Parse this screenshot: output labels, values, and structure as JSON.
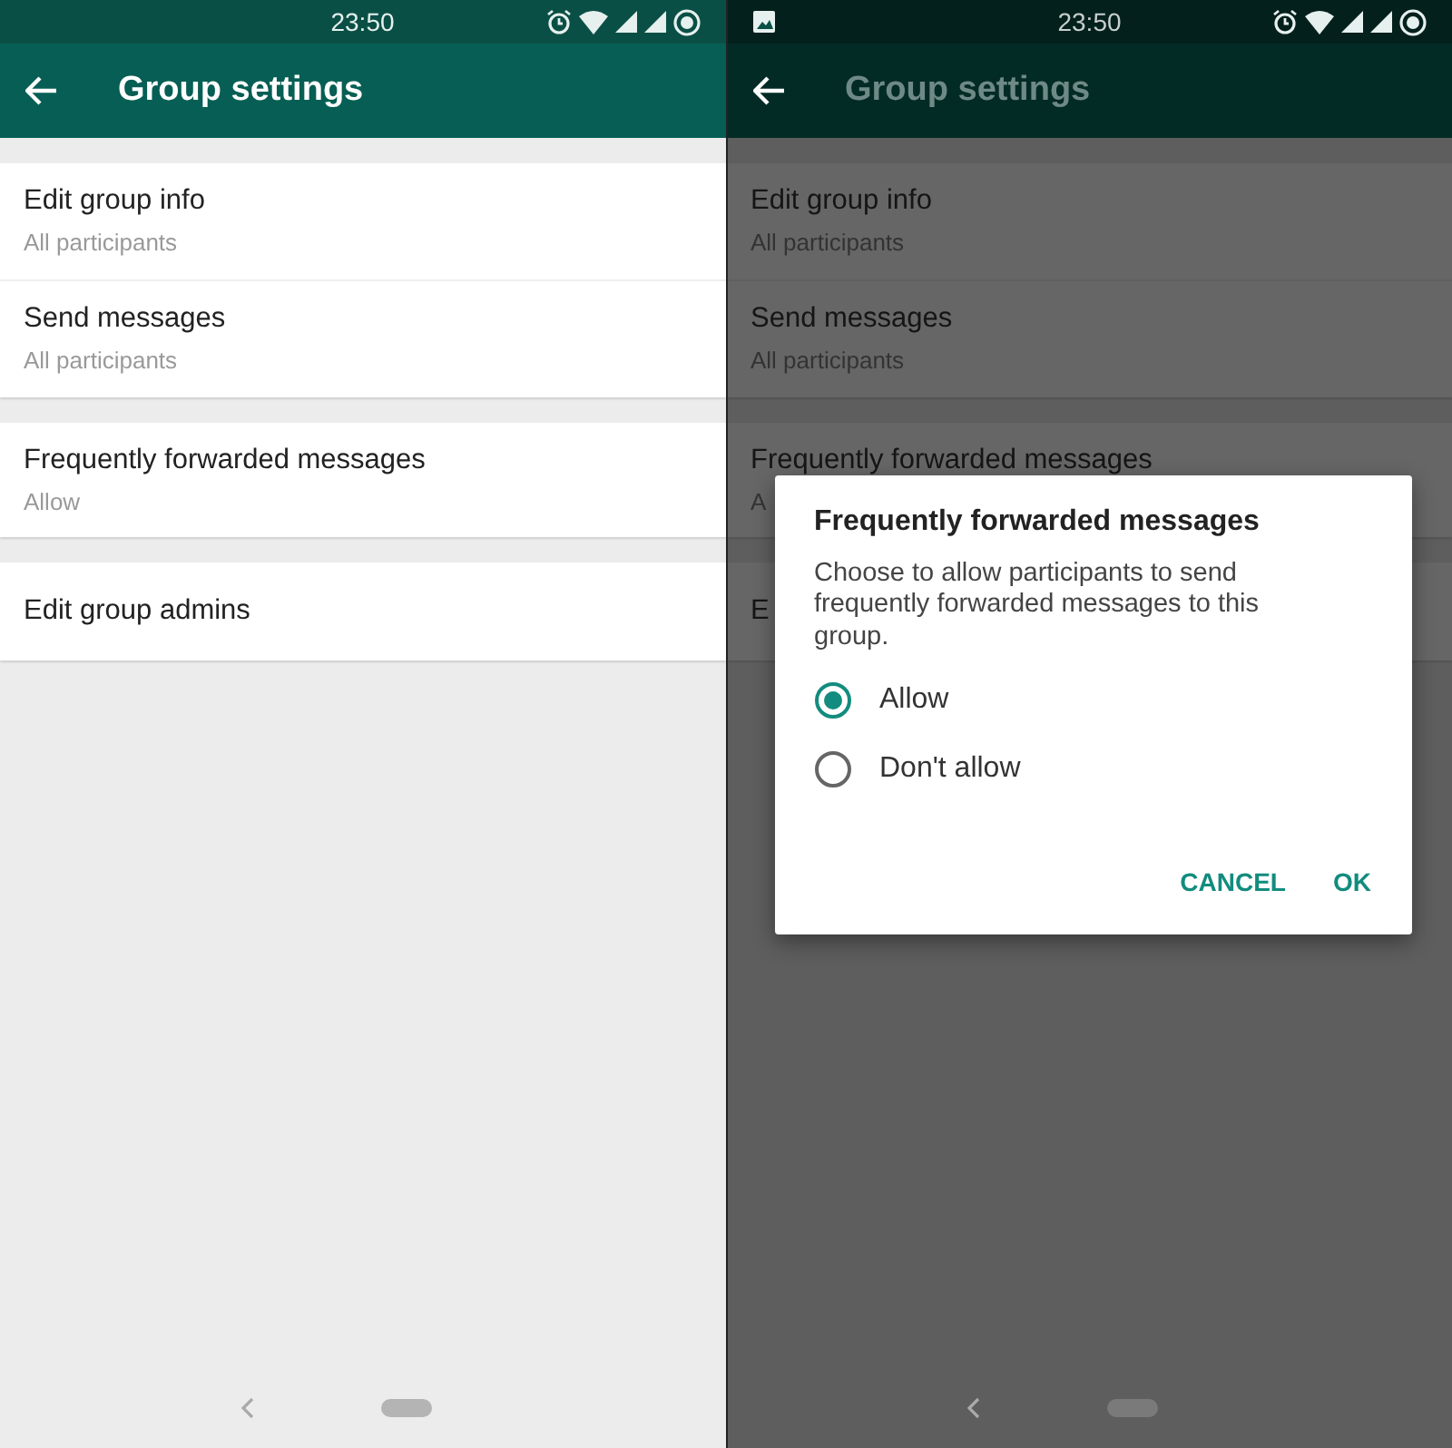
{
  "screens": [
    {
      "status_bar": {
        "time": "23:50",
        "notification": false
      },
      "app_bar": {
        "title": "Group settings"
      },
      "sections": [
        {
          "rows": [
            {
              "title": "Edit group info",
              "subtitle": "All participants"
            },
            {
              "title": "Send messages",
              "subtitle": "All participants"
            }
          ]
        },
        {
          "rows": [
            {
              "title": "Frequently forwarded messages",
              "subtitle": "Allow"
            }
          ]
        },
        {
          "rows": [
            {
              "title": "Edit group admins"
            }
          ]
        }
      ],
      "dimmed": false
    },
    {
      "status_bar": {
        "time": "23:50",
        "notification": true
      },
      "app_bar": {
        "title": "Group settings"
      },
      "sections": [
        {
          "rows": [
            {
              "title": "Edit group info",
              "subtitle": "All participants"
            },
            {
              "title": "Send messages",
              "subtitle": "All participants"
            }
          ]
        },
        {
          "rows": [
            {
              "title": "Frequently forwarded messages",
              "subtitle": "A"
            }
          ]
        },
        {
          "rows": [
            {
              "title": "E"
            }
          ]
        }
      ],
      "dimmed": true,
      "dialog": {
        "title": "Frequently forwarded messages",
        "message": "Choose to allow participants to send frequently forwarded messages to this group.",
        "options": [
          {
            "label": "Allow",
            "selected": true
          },
          {
            "label": "Don't allow",
            "selected": false
          }
        ],
        "buttons": [
          "CANCEL",
          "OK"
        ]
      }
    }
  ]
}
